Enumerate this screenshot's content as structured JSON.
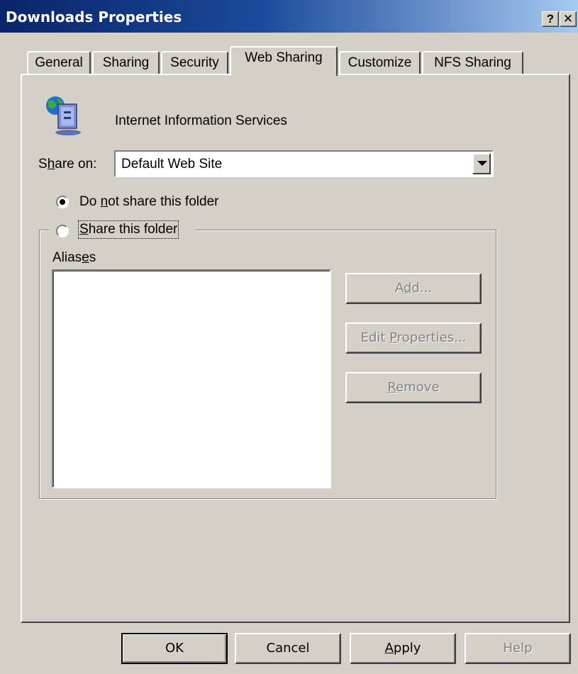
{
  "window": {
    "title": "Downloads Properties",
    "help_glyph": "?",
    "close_glyph": "✕"
  },
  "tabs": [
    {
      "label": "General"
    },
    {
      "label": "Sharing"
    },
    {
      "label": "Security"
    },
    {
      "label": "Web Sharing"
    },
    {
      "label": "Customize"
    },
    {
      "label": "NFS Sharing"
    }
  ],
  "active_tab": "Web Sharing",
  "service": {
    "name": "Internet Information Services",
    "icon": "iis-computer-globe-icon"
  },
  "share_on": {
    "label_pre": "S",
    "label_mnemonic": "h",
    "label_post": "are on:",
    "value": "Default Web Site"
  },
  "radio_not_share": {
    "pre": "Do ",
    "mnemonic": "n",
    "post": "ot share this folder",
    "checked": true
  },
  "radio_share": {
    "pre": "",
    "mnemonic": "S",
    "post": "hare this folder",
    "checked": false
  },
  "aliases": {
    "pre": "Alias",
    "mnemonic": "e",
    "post": "s",
    "items": []
  },
  "buttons": {
    "add": {
      "pre": "A",
      "mnemonic": "d",
      "post": "d..."
    },
    "edit": {
      "pre": "Edit ",
      "mnemonic": "P",
      "post": "roperties..."
    },
    "remove": {
      "pre": "",
      "mnemonic": "R",
      "post": "emove"
    }
  },
  "footer": {
    "ok": "OK",
    "cancel": "Cancel",
    "apply": {
      "pre": "",
      "mnemonic": "A",
      "post": "pply"
    },
    "help": "Help"
  }
}
